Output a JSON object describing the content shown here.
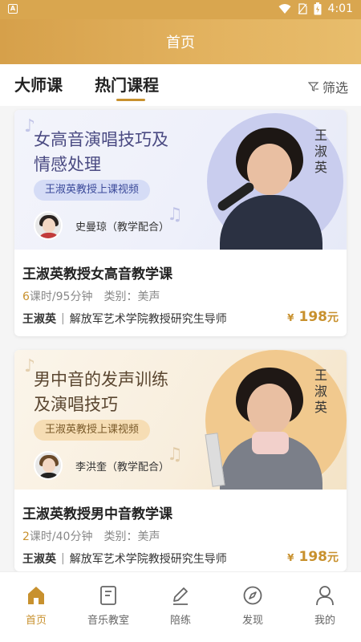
{
  "status_bar": {
    "time": "4:01",
    "app_indicator": "A"
  },
  "header": {
    "title": "首页"
  },
  "tabs": [
    {
      "label": "大师课",
      "active": false
    },
    {
      "label": "热门课程",
      "active": true
    }
  ],
  "filter": {
    "label": "筛选",
    "icon": "filter-icon"
  },
  "courses": [
    {
      "banner_title_line1": "女高音演唱技巧及",
      "banner_title_line2": "情感处理",
      "banner_subtitle": "王淑英教授上课视频",
      "assistant": "史曼琼（教学配合）",
      "teacher_vertical": "王淑英",
      "title": "王淑英教授女高音教学课",
      "lessons_num": "6",
      "lessons_rest": "课时/95分钟",
      "category": "类别：美声",
      "teacher": "王淑英",
      "teacher_desc": "解放军艺术学院教授研究生导师",
      "price_symbol": "¥",
      "price": "198",
      "price_unit": "元"
    },
    {
      "banner_title_line1": "男中音的发声训练",
      "banner_title_line2": "及演唱技巧",
      "banner_subtitle": "王淑英教授上课视频",
      "assistant": "李洪奎（教学配合）",
      "teacher_vertical": "王淑英",
      "title": "王淑英教授男中音教学课",
      "lessons_num": "2",
      "lessons_rest": "课时/40分钟",
      "category": "类别：美声",
      "teacher": "王淑英",
      "teacher_desc": "解放军艺术学院教授研究生导师",
      "price_symbol": "¥",
      "price": "198",
      "price_unit": "元"
    }
  ],
  "bottom_nav": [
    {
      "label": "首页",
      "icon": "home-icon",
      "active": true
    },
    {
      "label": "音乐教室",
      "icon": "book-icon",
      "active": false
    },
    {
      "label": "陪练",
      "icon": "pencil-icon",
      "active": false
    },
    {
      "label": "发现",
      "icon": "compass-icon",
      "active": false
    },
    {
      "label": "我的",
      "icon": "user-icon",
      "active": false
    }
  ],
  "colors": {
    "accent": "#c8912e",
    "header": "#d9a64f"
  }
}
